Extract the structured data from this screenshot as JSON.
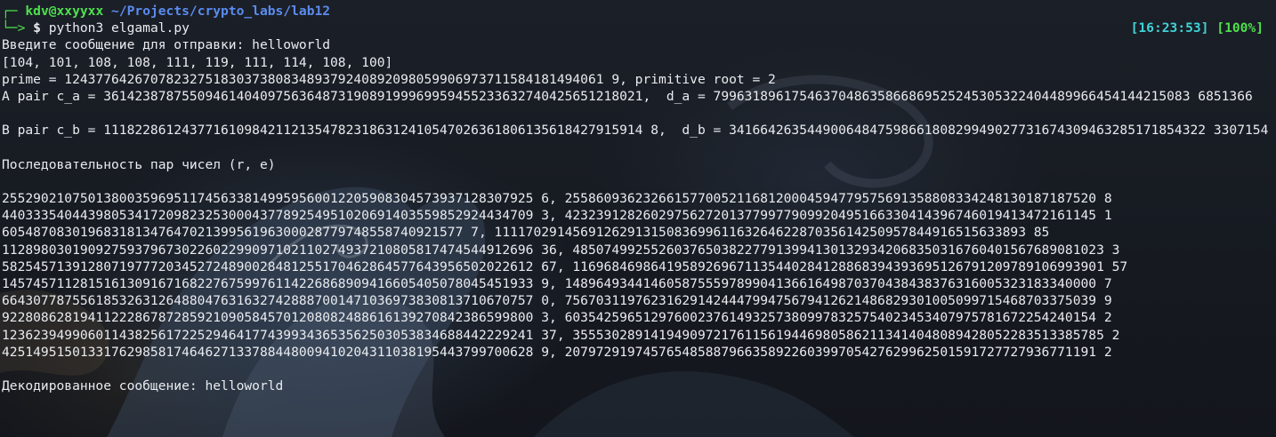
{
  "terminal": {
    "prompt": {
      "corner_top": "┌─",
      "user_host": "kdv@xxyyxx",
      "path": "~/Projects/crypto_labs/lab12",
      "corner_bottom": "└─>",
      "dollar": "$",
      "command": "python3 elgamal.py"
    },
    "status": {
      "time": "[16:23:53]",
      "battery": "[100%]"
    },
    "output": {
      "input_prompt": "Введите сообщение для отправки: helloworld",
      "codes": "[104, 101, 108, 108, 111, 119, 111, 114, 108, 100]",
      "prime_line": "prime = 124377642670782327518303738083489379240892098059906973711584181494061 9, primitive root = 2",
      "a_pair": "A pair c_a = 361423878755094614040975636487319089199969959455233632740425651218021,  d_a = 7996318961754637048635866869525245305322404489966454144215083 6851366",
      "b_pair": "B pair c_b = 111822861243771610984211213547823186312410547026361806135618427915914 8,  d_b = 3416642635449006484759866180829949027731674309463285171854322 3307154",
      "sequence_title": "Последовательность пар чисел (r, e)",
      "pairs": [
        "25529021075013800359695117456338149959560012205908304573937128307925 6, 25586093623266157700521168120004594779575691358808334248130187187520 8",
        "44033354044398053417209823253000437789254951020691403559852924434709 3, 42323912826029756272013779977909920495166330414396746019413472161145 1",
        "60548708301968318134764702139956196300028779748558740921577 7, 11117029145691262913150836996116326462287035614250957844916515633893 85",
        "11289803019092759379673022602299097102110274937210805817474544912696 36, 48507499255260376503822779139941301329342068350316760401567689081023 3",
        "58254571391280719777203452724890028481255170462864577643956502022612 67, 11696846986419589269671135440284128868394393695126791209789106993901 57",
        "14574571128151613091671682276759976114226868909416605405078045451933 9, 14896493441460587555978990413661649870370438438376316005323183340000 7",
        "66430778755618532631264880476316327428887001471036973830813710670757 0, 75670311976231629142444799475679412621486829301005099715468703375039 9",
        "92280862819411222867872859210905845701208082488616139270842386599800 3, 60354259651297600237614932573809978325754023453407975781672254240154 2",
        "12362394990601143825617225294641774399343653562503053834688442229241 37, 35553028914194909721761156194469805862113414048089428052283513385785 2",
        "42514951501331762985817464627133788448009410204311038195443799700628 9, 20797291974576548588796635892260399705427629962501591727727936771191 2"
      ],
      "decoded": "Декодированное сообщение: helloworld"
    }
  }
}
